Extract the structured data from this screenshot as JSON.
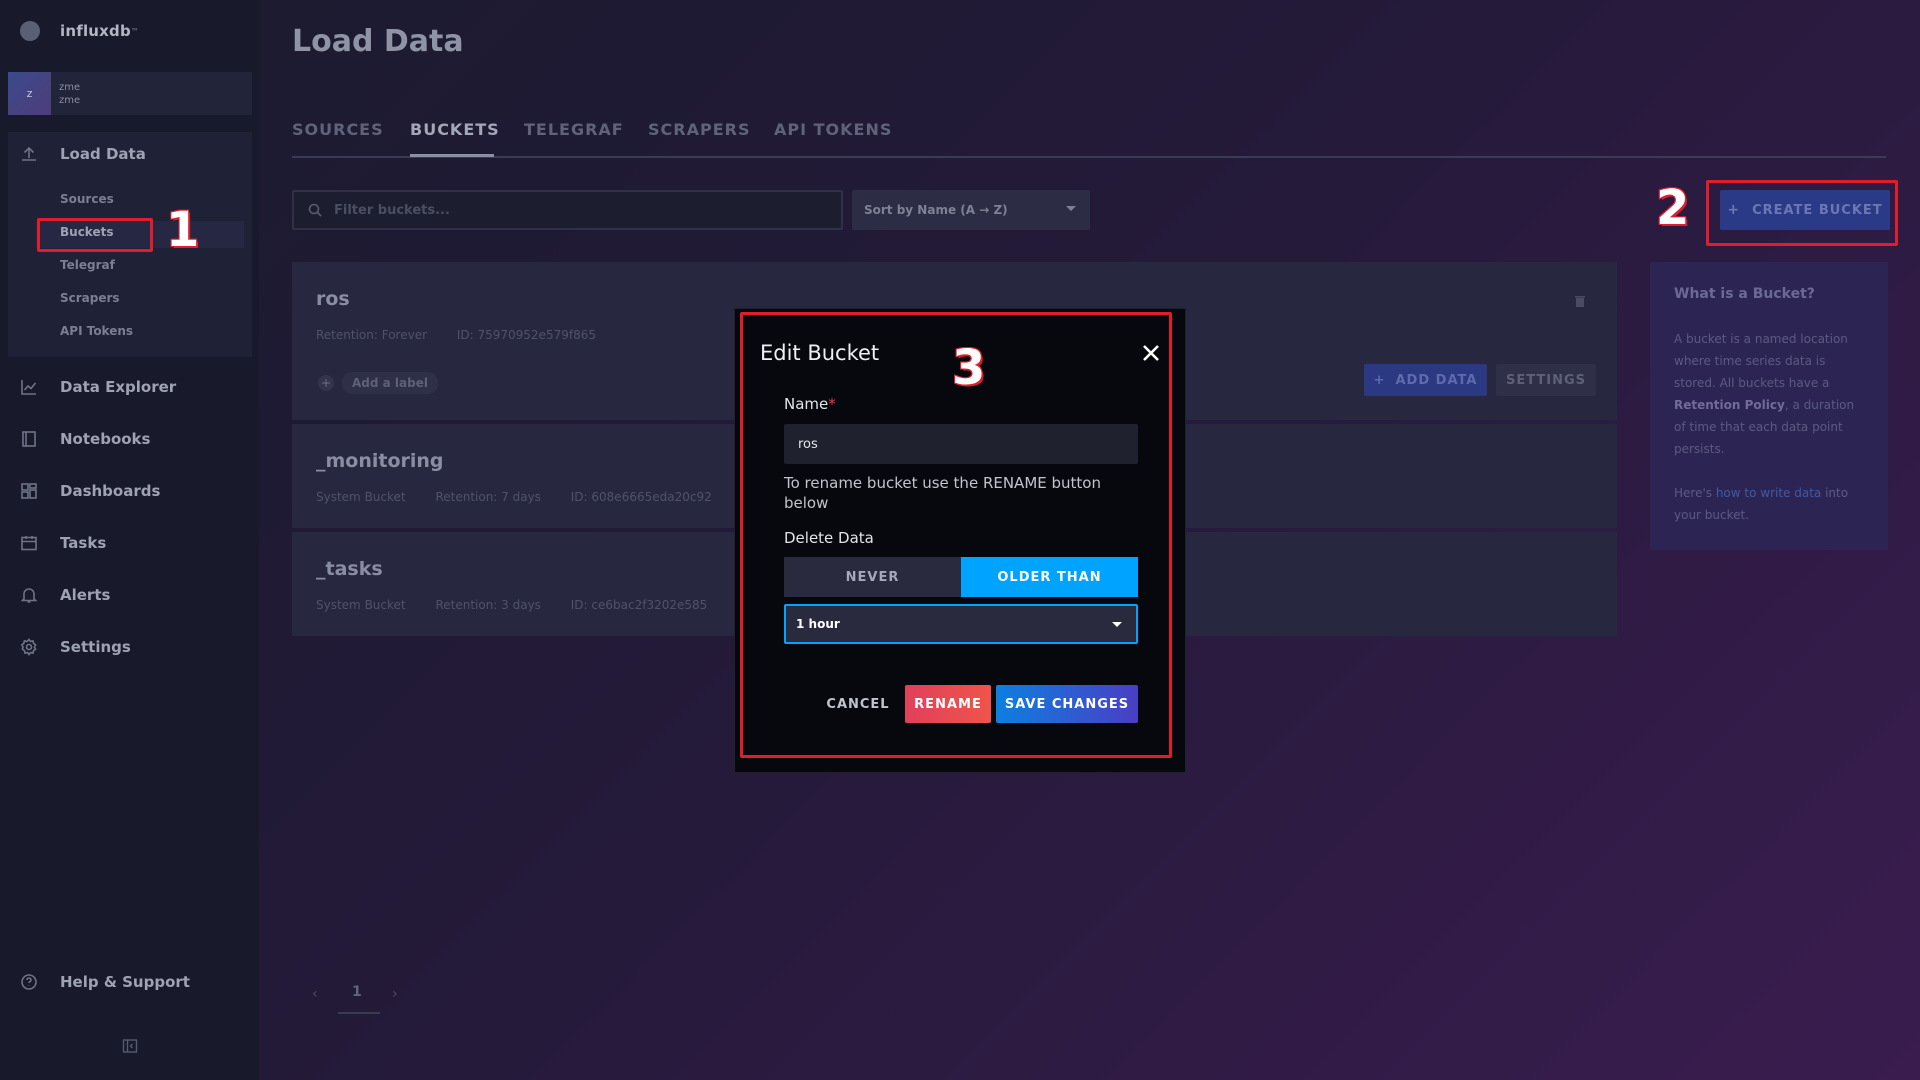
{
  "brand": {
    "name": "influxdb",
    "tm": "™"
  },
  "user": {
    "initial": "z",
    "org": "zme",
    "name": "zme"
  },
  "sidebar": {
    "load_data": "Load Data",
    "sub_items": [
      "Sources",
      "Buckets",
      "Telegraf",
      "Scrapers",
      "API Tokens"
    ],
    "active_sub": "Buckets",
    "items": [
      {
        "label": "Data Explorer",
        "icon": "chart-icon"
      },
      {
        "label": "Notebooks",
        "icon": "notebook-icon"
      },
      {
        "label": "Dashboards",
        "icon": "dashboard-icon"
      },
      {
        "label": "Tasks",
        "icon": "calendar-icon"
      },
      {
        "label": "Alerts",
        "icon": "bell-icon"
      },
      {
        "label": "Settings",
        "icon": "gear-icon"
      }
    ],
    "help": "Help & Support"
  },
  "page": {
    "title": "Load Data"
  },
  "tabs": [
    "SOURCES",
    "BUCKETS",
    "TELEGRAF",
    "SCRAPERS",
    "API TOKENS"
  ],
  "active_tab": "BUCKETS",
  "toolbar": {
    "filter_placeholder": "Filter buckets...",
    "sort_label": "Sort by Name (A → Z)",
    "create_label": "CREATE BUCKET",
    "create_plus": "+"
  },
  "buckets": [
    {
      "name": "ros",
      "meta": [
        "Retention: Forever",
        "ID: 75970952e579f865"
      ],
      "add_label": "Add a label",
      "add_data": "ADD DATA",
      "settings": "SETTINGS"
    },
    {
      "name": "_monitoring",
      "meta": [
        "System Bucket",
        "Retention: 7 days",
        "ID: 608e6665eda20c92"
      ]
    },
    {
      "name": "_tasks",
      "meta": [
        "System Bucket",
        "Retention: 3 days",
        "ID: ce6bac2f3202e585"
      ]
    }
  ],
  "info": {
    "title": "What is a Bucket?",
    "p1_before": "A bucket is a named location where time series data is stored. All buckets have a ",
    "p1_bold": "Retention Policy",
    "p1_after": ", a duration of time that each data point persists.",
    "p2_before": "Here's ",
    "p2_link": "how to write data",
    "p2_after": " into your bucket."
  },
  "pagination": {
    "current": "1",
    "prev": "‹",
    "next": "›"
  },
  "annotations": [
    "1",
    "2",
    "3"
  ],
  "modal": {
    "title": "Edit Bucket",
    "name_label": "Name",
    "required_mark": "*",
    "name_value": "ros",
    "rename_hint": "To rename bucket use the RENAME button below",
    "delete_label": "Delete Data",
    "never_label": "NEVER",
    "older_label": "OLDER THAN",
    "duration": "1 hour",
    "cancel": "CANCEL",
    "rename": "RENAME",
    "save": "SAVE CHANGES"
  },
  "colors": {
    "accent": "#00a3ff",
    "annotation": "#e01e2b",
    "rename": "#e0405b"
  }
}
